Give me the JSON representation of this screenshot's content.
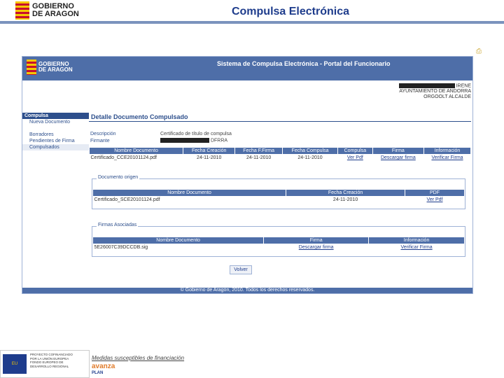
{
  "slide": {
    "title": "Compulsa Electrónica",
    "logo_line1": "GOBIERNO",
    "logo_line2": "DE ARAGON"
  },
  "app": {
    "system_title": "Sistema de Compulsa Electrónica - Portal del Funcionario",
    "logo_line1": "GOBIERNO",
    "logo_line2": "DE ARAGON",
    "user": {
      "line1": "IRENE",
      "line2": "AYUNTAMIENTO DE ANDORRA",
      "line3": "ORGOOLT ALCALDE"
    },
    "sidebar": {
      "section1": "Compulsa",
      "item_new": "Nueva Documento",
      "item_drafts": "Borradores",
      "item_pending": "Pendientes de Firma",
      "item_done": "Compulsados"
    },
    "detail": {
      "title": "Detalle Documento Compulsado",
      "desc_label": "Descripción",
      "desc_value": "Certificado de título de compulsa",
      "signer_label": "Firmante",
      "signer_value": "DFRRA"
    },
    "main_table": {
      "headers": [
        "Nombre Documento",
        "Fecha Creación",
        "Fecha F.Firma",
        "Fecha Compulsa",
        "Compulsa",
        "Firma",
        "Información"
      ],
      "row": [
        "Certificado_CCE20101124.pdf",
        "24-11-2010",
        "24-11-2010",
        "24-11-2010",
        "Ver Pdf",
        "Descargar firma",
        "Verificar Firma"
      ]
    },
    "origin": {
      "legend": "Documento origen",
      "headers": [
        "Nombre Documento",
        "Fecha Creación",
        "PDF"
      ],
      "row": [
        "Certificado_SCE20101124.pdf",
        "24-11-2010",
        "Ver Pdf"
      ]
    },
    "signatures": {
      "legend": "Firmas Asociadas",
      "headers": [
        "Nombre Documento",
        "Firma",
        "Información"
      ],
      "row": [
        "5E26007C39DCCDB.sig",
        "Descargar firma",
        "Verificar Firma"
      ]
    },
    "back_label": "Volver",
    "footer": "© Gobierno de Aragón, 2010. Todos los derechos reservados."
  },
  "bottom": {
    "eu_label": "EU",
    "eu_line1": "PROYECTO COFINANCIADO",
    "eu_line2": "POR LA UNIÓN EUROPEA",
    "eu_line3": "FONDO EUROPEO DE",
    "eu_line4": "DESARROLLO REGIONAL",
    "medidas": "Medidas susceptibles de financiación",
    "logo2": "avanza",
    "logo3": "PLAN"
  },
  "colors": {
    "accent": "#4e6ea8",
    "title": "#1e3c8c"
  }
}
